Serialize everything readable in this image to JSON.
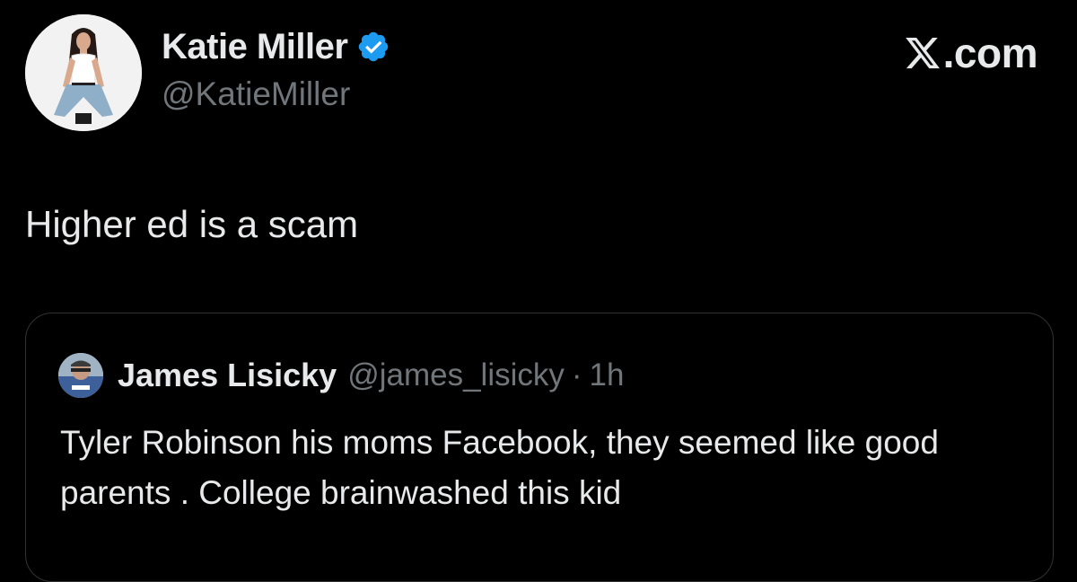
{
  "tweet": {
    "author": {
      "name": "Katie Miller",
      "handle": "@KatieMiller",
      "verified": true,
      "avatar_icon": "profile-photo"
    },
    "text": "Higher ed is a scam"
  },
  "brand": {
    "logo_icon": "x-logo-icon",
    "suffix": ".com"
  },
  "quoted_tweet": {
    "author": {
      "name": "James Lisicky",
      "handle": "@james_lisicky",
      "avatar_icon": "profile-photo"
    },
    "separator": "·",
    "time": "1h",
    "text": "Tyler Robinson his moms Facebook, they seemed like good parents . College brainwashed this kid"
  },
  "colors": {
    "background": "#000000",
    "primary_text": "#e7e9ea",
    "secondary_text": "#71767b",
    "verified_badge": "#1d9bf0",
    "card_border": "#2f3336"
  }
}
